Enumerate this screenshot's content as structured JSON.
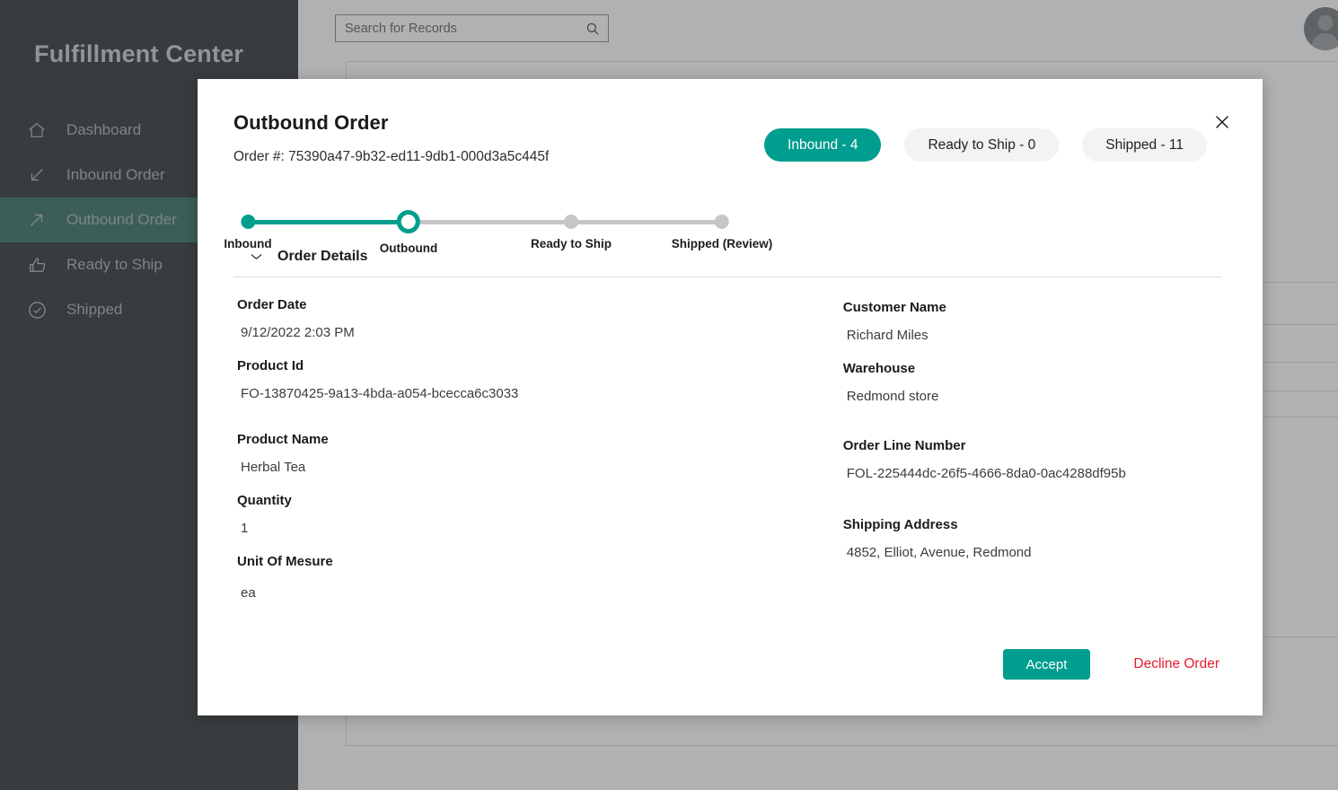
{
  "app": {
    "title": "Fulfillment Center",
    "accent_color": "#009e8e",
    "sidebar_bg": "#2b2f31",
    "danger_color": "#e8192c"
  },
  "sidebar": {
    "items": [
      {
        "label": "Dashboard",
        "icon": "home-icon",
        "active": false
      },
      {
        "label": "Inbound Order",
        "icon": "arrow-down-left-icon",
        "active": false
      },
      {
        "label": "Outbound Order",
        "icon": "arrow-up-right-icon",
        "active": true
      },
      {
        "label": "Ready to Ship",
        "icon": "thumbs-up-icon",
        "active": false
      },
      {
        "label": "Shipped",
        "icon": "check-circle-icon",
        "active": false
      }
    ]
  },
  "topbar": {
    "search": {
      "placeholder": "Search for Records",
      "value": "",
      "icon": "search-icon"
    },
    "avatar_icon": "user-avatar-icon"
  },
  "modal": {
    "title": "Outbound Order",
    "order_number_label": "Order #: 75390a47-9b32-ed11-9db1-000d3a5c445f",
    "close_icon": "close-icon",
    "pills": [
      {
        "label": "Inbound - 4",
        "active": true
      },
      {
        "label": "Ready to Ship - 0",
        "active": false
      },
      {
        "label": "Shipped - 11",
        "active": false
      }
    ],
    "stepper": {
      "steps": [
        {
          "label": "Inbound",
          "state": "done"
        },
        {
          "label": "Outbound",
          "state": "current"
        },
        {
          "label": "Ready to Ship",
          "state": "upcoming"
        },
        {
          "label": "Shipped (Review)",
          "state": "upcoming"
        }
      ]
    },
    "details": {
      "section_title": "Order Details",
      "chevron_icon": "chevron-down-icon",
      "left_fields": [
        {
          "label": "Order Date",
          "value": "9/12/2022 2:03 PM"
        },
        {
          "label": "Product Id",
          "value": "FO-13870425-9a13-4bda-a054-bcecca6c3033"
        },
        {
          "label": "Product Name",
          "value": "Herbal Tea"
        },
        {
          "label": "Quantity",
          "value": "1"
        },
        {
          "label": "Unit Of Mesure",
          "value": "ea"
        }
      ],
      "right_fields": [
        {
          "label": "Customer Name",
          "value": "Richard Miles"
        },
        {
          "label": "Warehouse",
          "value": "Redmond store"
        },
        {
          "label": "Order Line Number",
          "value": "FOL-225444dc-26f5-4666-8da0-0ac4288df95b"
        },
        {
          "label": "Shipping Address",
          "value": "4852, Elliot, Avenue, Redmond"
        }
      ]
    },
    "actions": {
      "accept_label": "Accept",
      "decline_label": "Decline Order"
    }
  }
}
